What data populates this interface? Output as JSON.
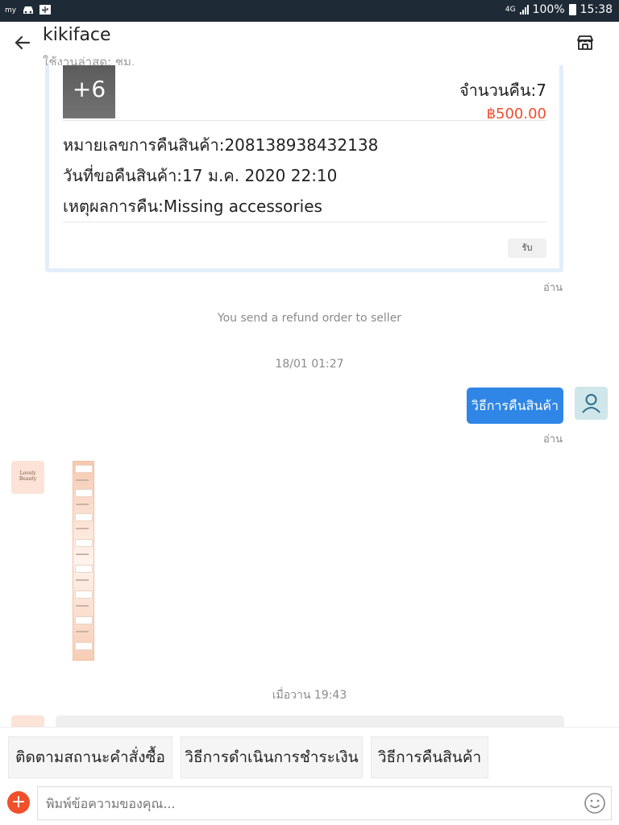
{
  "status_bar": {
    "left_icons": [
      "app-icon",
      "car-icon",
      "usb-icon"
    ],
    "network": "4G",
    "battery": "100%",
    "time": "15:38"
  },
  "header": {
    "title": "kikiface",
    "subtitle": "ใช้งานล่าสุด: ชม."
  },
  "refund_card": {
    "more_images": "+6",
    "quantity": "จำนวนคืน:7",
    "price": "฿500.00",
    "refund_number": "หมายเลขการคืนสินค้า:208138938432138",
    "request_date": "วันที่ขอคืนสินค้า:17 ม.ค. 2020 22:10",
    "reason": "เหตุผลการคืน:Missing accessories",
    "accept_label": "รับ",
    "read_label": "อ่าน"
  },
  "messages": {
    "refund_sent": "You send a refund order to seller",
    "time1": "18/01 01:27",
    "outgoing_text": "วิธีการคืนสินค้า",
    "outgoing_read": "อ่าน",
    "shop_avatar_text": "Lovely Beauty",
    "time2": "เมื่อวาน 19:43"
  },
  "quick_replies": [
    "ติดตามสถานะคำสั่งซื้อ",
    "วิธีการดำเนินการชำระเงิน",
    "วิธีการคืนสินค้า"
  ],
  "input": {
    "placeholder": "พิมพ์ข้อความของคุณ..."
  },
  "colors": {
    "accent_blue": "#2f86e6",
    "shopee_orange": "#ee4d2d",
    "status_bar": "#1f2a37"
  }
}
